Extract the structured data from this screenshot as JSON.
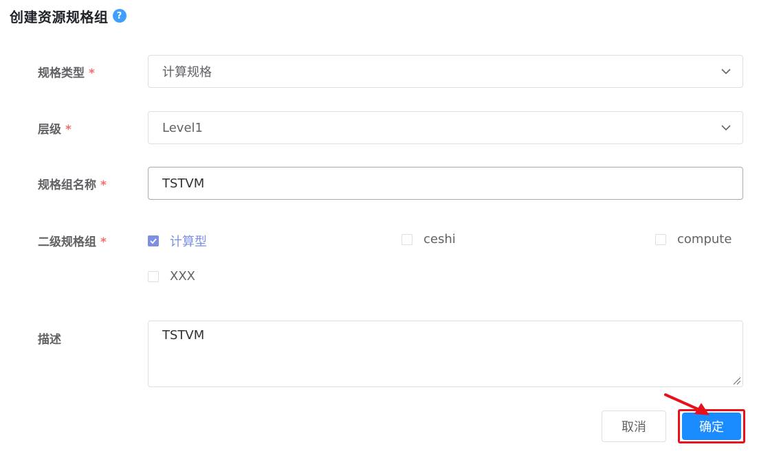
{
  "header": {
    "title": "创建资源规格组",
    "help_icon_glyph": "?"
  },
  "form": {
    "spec_type": {
      "label": "规格类型",
      "required_mark": "*",
      "value": "计算规格"
    },
    "level": {
      "label": "层级",
      "required_mark": "*",
      "value": "Level1"
    },
    "group_name": {
      "label": "规格组名称",
      "required_mark": "*",
      "value": "TSTVM"
    },
    "sub_groups": {
      "label": "二级规格组",
      "required_mark": "*",
      "options": [
        {
          "label": "计算型",
          "checked": true
        },
        {
          "label": "ceshi",
          "checked": false
        },
        {
          "label": "compute",
          "checked": false
        },
        {
          "label": "XXX",
          "checked": false
        }
      ]
    },
    "description": {
      "label": "描述",
      "value": "TSTVM"
    }
  },
  "actions": {
    "cancel_label": "取消",
    "confirm_label": "确定"
  },
  "colors": {
    "primary": "#1a8cff",
    "checkbox_checked": "#7c8fe0",
    "required": "#f56c6c",
    "annotation_red": "#e8101a",
    "help_icon": "#409eff"
  },
  "icons": {
    "help": "help-icon",
    "dropdown": "chevron-down-icon",
    "check": "check-icon",
    "resize": "resize-handle-icon",
    "annotation": "red-arrow-icon"
  }
}
